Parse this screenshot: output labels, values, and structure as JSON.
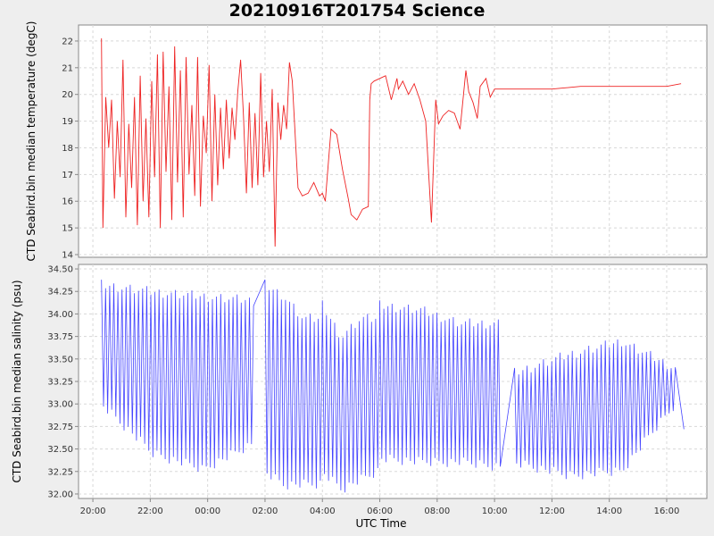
{
  "title": "20210916T201754 Science",
  "chart_data": {
    "type": "line",
    "xlabel": "UTC Time",
    "x_ticks": [
      "20:00",
      "22:00",
      "00:00",
      "02:00",
      "04:00",
      "06:00",
      "08:00",
      "10:00",
      "12:00",
      "14:00",
      "16:00"
    ],
    "x_tick_hours": [
      20,
      22,
      24,
      26,
      28,
      30,
      32,
      34,
      36,
      38,
      40
    ],
    "x_range_hours": [
      19.5,
      41.4
    ],
    "grid": true,
    "panels": [
      {
        "ylabel": "CTD Seabird.bin median temperature (degC)",
        "ylim": [
          13.9,
          22.6
        ],
        "y_ticks": [
          "14",
          "15",
          "16",
          "17",
          "18",
          "19",
          "20",
          "21",
          "22"
        ],
        "y_tick_values": [
          14,
          15,
          16,
          17,
          18,
          19,
          20,
          21,
          22
        ],
        "color": "#ee2222",
        "series": [
          {
            "x_hours": [
              20.3,
              20.35,
              20.45,
              20.55,
              20.65,
              20.75,
              20.85,
              20.95,
              21.05,
              21.15,
              21.25,
              21.35,
              21.45,
              21.55,
              21.65,
              21.75,
              21.85,
              21.95,
              22.05,
              22.15,
              22.25,
              22.35,
              22.45,
              22.55,
              22.65,
              22.75,
              22.85,
              22.95,
              23.05,
              23.15,
              23.25,
              23.35,
              23.45,
              23.55,
              23.65,
              23.75,
              23.85,
              23.95,
              24.05,
              24.15,
              24.25,
              24.35,
              24.45,
              24.55,
              24.65,
              24.75,
              24.85,
              24.95,
              25.05,
              25.15,
              25.25,
              25.35,
              25.45,
              25.55,
              25.65,
              25.75,
              25.85,
              25.95,
              26.05,
              26.15,
              26.25,
              26.35,
              26.45,
              26.55,
              26.65,
              26.75,
              26.85,
              26.95,
              27.05,
              27.15,
              27.3,
              27.5,
              27.7,
              27.9,
              28.0,
              28.1,
              28.3,
              28.5,
              28.7,
              28.9,
              29.0,
              29.2,
              29.4,
              29.6,
              29.65,
              29.7,
              29.8,
              30.0,
              30.2,
              30.4,
              30.6,
              30.65,
              30.8,
              31.0,
              31.2,
              31.4,
              31.6,
              31.8,
              31.95,
              32.05,
              32.2,
              32.4,
              32.6,
              32.8,
              33.0,
              33.1,
              33.25,
              33.4,
              33.5,
              33.7,
              33.85,
              34.0,
              34.2,
              34.4,
              35.0,
              36.0,
              37.0,
              38.0,
              39.0,
              40.0,
              40.5
            ],
            "y": [
              22.1,
              15.0,
              19.9,
              18.0,
              19.8,
              16.1,
              19.0,
              16.9,
              21.3,
              15.4,
              18.9,
              16.5,
              19.9,
              15.1,
              20.7,
              16.0,
              19.1,
              15.4,
              20.5,
              16.9,
              21.5,
              15.0,
              21.6,
              17.1,
              20.3,
              15.3,
              21.8,
              16.7,
              20.9,
              15.4,
              21.4,
              17.0,
              19.6,
              16.2,
              21.4,
              15.8,
              19.2,
              17.8,
              21.1,
              16.0,
              20.0,
              16.6,
              19.5,
              17.2,
              19.8,
              17.6,
              19.5,
              18.3,
              20.1,
              21.3,
              19.2,
              16.3,
              19.7,
              16.5,
              19.3,
              16.6,
              20.8,
              16.9,
              19.0,
              17.1,
              20.2,
              14.3,
              19.7,
              18.3,
              19.6,
              18.7,
              21.2,
              20.5,
              18.5,
              16.5,
              16.2,
              16.3,
              16.7,
              16.2,
              16.3,
              16.0,
              18.7,
              18.5,
              17.2,
              16.1,
              15.5,
              15.3,
              15.7,
              15.8,
              19.8,
              20.4,
              20.5,
              20.6,
              20.7,
              19.8,
              20.6,
              20.2,
              20.5,
              20.0,
              20.4,
              19.8,
              19.0,
              15.2,
              19.8,
              18.9,
              19.2,
              19.4,
              19.3,
              18.7,
              20.9,
              20.1,
              19.7,
              19.1,
              20.3,
              20.6,
              19.9,
              20.2,
              20.2,
              20.2,
              20.2,
              20.2,
              20.3,
              20.3,
              20.3,
              20.3,
              20.4
            ]
          }
        ]
      },
      {
        "ylabel": "CTD Seabird.bin median salinity (psu)",
        "ylim": [
          31.95,
          34.55
        ],
        "y_ticks": [
          "32.00",
          "32.25",
          "32.50",
          "32.75",
          "33.00",
          "33.25",
          "33.50",
          "33.75",
          "34.00",
          "34.25",
          "34.50"
        ],
        "y_tick_values": [
          32.0,
          32.25,
          32.5,
          32.75,
          33.0,
          33.25,
          33.5,
          33.75,
          34.0,
          34.25,
          34.5
        ],
        "color": "#4444ff",
        "series": [
          {
            "segments": [
              {
                "x_start": 20.3,
                "x_end": 25.6,
                "high": [
                  34.38,
                  34.3,
                  34.25,
                  34.2
                ],
                "low": [
                  32.95,
                  32.4,
                  32.22,
                  32.5
                ]
              },
              {
                "x_start": 26.0,
                "x_end": 28.0,
                "high": [
                  34.38,
                  34.25,
                  34.0,
                  34.0
                ],
                "low": [
                  32.2,
                  32.05,
                  32.05,
                  32.05
                ]
              },
              {
                "x_start": 28.0,
                "x_end": 30.0,
                "high": [
                  34.15,
                  33.8,
                  34.0,
                  34.0
                ],
                "low": [
                  32.2,
                  32.0,
                  32.1,
                  32.2
                ]
              },
              {
                "x_start": 30.0,
                "x_end": 34.2,
                "high": [
                  34.15,
                  34.1,
                  33.95,
                  33.95
                ],
                "low": [
                  32.35,
                  32.3,
                  32.3,
                  32.25
                ]
              },
              {
                "x_start": 34.7,
                "x_end": 40.3,
                "high": [
                  33.4,
                  33.6,
                  33.75,
                  33.45
                ],
                "low": [
                  32.3,
                  32.15,
                  32.2,
                  32.95
                ]
              }
            ],
            "end_value": 32.72
          }
        ]
      }
    ]
  }
}
